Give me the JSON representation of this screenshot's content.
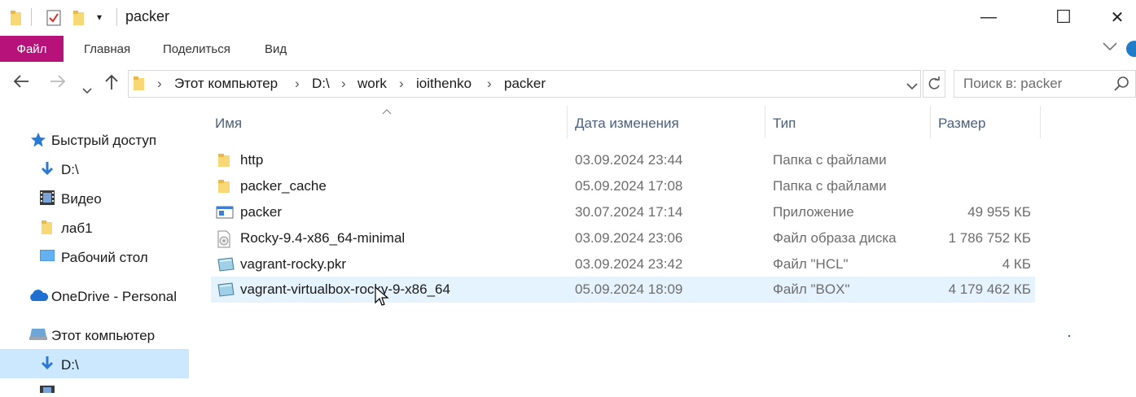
{
  "window": {
    "title": "packer",
    "minimize": "—",
    "maximize": "☐",
    "close": "✕"
  },
  "ribbon": {
    "file": "Файл",
    "tabs": [
      "Главная",
      "Поделиться",
      "Вид"
    ]
  },
  "address": {
    "crumbs": [
      "Этот компьютер",
      "D:\\",
      "work",
      "ioithenko",
      "packer"
    ],
    "search_placeholder": "Поиск в: packer"
  },
  "sidebar": {
    "items": [
      {
        "label": "Быстрый доступ",
        "icon": "star-icon"
      },
      {
        "label": "D:\\",
        "icon": "download-arrow-icon"
      },
      {
        "label": "Видео",
        "icon": "video-icon"
      },
      {
        "label": "лаб1",
        "icon": "folder-icon"
      },
      {
        "label": "Рабочий стол",
        "icon": "desktop-icon"
      },
      {
        "label": "OneDrive - Personal",
        "icon": "cloud-icon"
      },
      {
        "label": "Этот компьютер",
        "icon": "computer-icon"
      },
      {
        "label": "D:\\",
        "icon": "download-arrow-icon"
      }
    ]
  },
  "columns": {
    "name": "Имя",
    "date": "Дата изменения",
    "type": "Тип",
    "size": "Размер"
  },
  "files": [
    {
      "name": "http",
      "date": "03.09.2024 23:44",
      "type": "Папка с файлами",
      "size": "",
      "icon": "folder-icon"
    },
    {
      "name": "packer_cache",
      "date": "05.09.2024 17:08",
      "type": "Папка с файлами",
      "size": "",
      "icon": "folder-icon"
    },
    {
      "name": "packer",
      "date": "30.07.2024 17:14",
      "type": "Приложение",
      "size": "49 955 КБ",
      "icon": "application-icon"
    },
    {
      "name": "Rocky-9.4-x86_64-minimal",
      "date": "03.09.2024 23:06",
      "type": "Файл образа диска",
      "size": "1 786 752 КБ",
      "icon": "disc-image-icon"
    },
    {
      "name": "vagrant-rocky.pkr",
      "date": "03.09.2024 23:42",
      "type": "Файл \"HCL\"",
      "size": "4 КБ",
      "icon": "file-generic-icon"
    },
    {
      "name": "vagrant-virtualbox-rocky-9-x86_64",
      "date": "05.09.2024 18:09",
      "type": "Файл \"BOX\"",
      "size": "4 179 462 КБ",
      "icon": "file-generic-icon"
    }
  ],
  "colors": {
    "file_tab": "#b6127a",
    "selection": "#cce8ff",
    "hover_row": "#e5f3ff"
  }
}
